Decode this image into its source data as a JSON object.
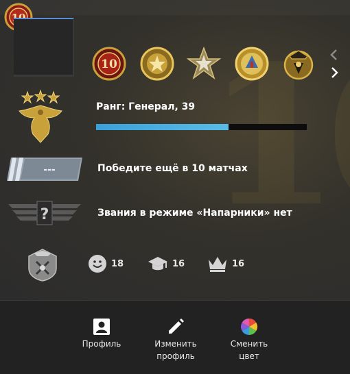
{
  "profile": {
    "rank_text": "Ранг: Генерал, 39",
    "xp_progress": 0.63,
    "matchmaking_text": "Победите ещё в 10 матчах",
    "matchmaking_placeholder": "---",
    "wingman_text": "Звания в режиме «Напарники» нет",
    "corner_medal_number": "10"
  },
  "medals": [
    {
      "icon": "service-medal-10-icon",
      "label": "10"
    },
    {
      "icon": "gold-star-medal-icon",
      "label": ""
    },
    {
      "icon": "silver-star-medal-icon",
      "label": ""
    },
    {
      "icon": "gold-coin-medal-icon",
      "label": ""
    },
    {
      "icon": "operation-medal-icon",
      "label": ""
    }
  ],
  "stats": {
    "friendly": "18",
    "teacher": "16",
    "leader": "16"
  },
  "footer": {
    "profile_label": "Профиль",
    "edit_label": "Изменить\nпрофиль",
    "color_label": "Сменить\nцвет"
  },
  "colors": {
    "xp_fill": "#58bce8",
    "accent_gold": "#c9a13b"
  }
}
